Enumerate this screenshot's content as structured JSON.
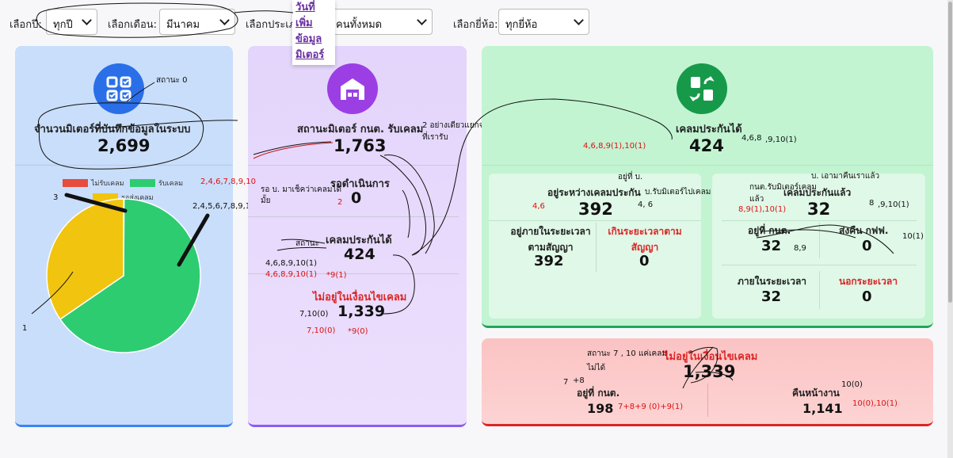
{
  "filters": {
    "year_label": "เลือกปี:",
    "year_value": "ทุกปี",
    "month_label": "เลือกเดือน:",
    "month_value": "มีนาคม",
    "type_label": "เลือกประเภ",
    "type_value": "คนทั้งหมด",
    "brand_label": "เลือกยี่ห้อ:",
    "brand_value": "ทุกยี่ห้อ"
  },
  "popup": {
    "line1": "วันที่",
    "line2": "เพิ่ม",
    "line3": "ข้อมูล",
    "line4": "มิเตอร์"
  },
  "card1": {
    "title": "จำนวนมิเตอร์ที่บันทึกข้อมูลในระบบ",
    "value": "2,699",
    "legend": [
      {
        "label": "ไม่รับเคลม",
        "color": "#e74c3c"
      },
      {
        "label": "รับเคลม",
        "color": "#2ecc71"
      },
      {
        "label": "รอส่งเคลม",
        "color": "#f1c40f"
      }
    ]
  },
  "chart_data": {
    "type": "pie",
    "categories": [
      "ไม่รับเคลม",
      "รับเคลม",
      "รอส่งเคลม"
    ],
    "values": [
      3,
      1763,
      933
    ],
    "colors": [
      "#e74c3c",
      "#2ecc71",
      "#f1c40f"
    ]
  },
  "card2": {
    "title": "สถานะมิเตอร์ กนต. รับเคลม",
    "value": "1,763",
    "pending_label": "รอดำเนินการ",
    "pending_value": "0",
    "claimable_label": "เคลมประกันได้",
    "claimable_value": "424",
    "notdam_label": "ไม่อยู่ในเงื่อนไขเคลม",
    "notdam_value": "1,339"
  },
  "card3": {
    "title": "เคลมประกันได้",
    "value": "424",
    "left_title": "อยู่ระหว่างเคลมประกัน",
    "left_value": "392",
    "left_a_label": "อยู่ภายในระยะเวลาตามสัญญา",
    "left_a_value": "392",
    "left_b_label": "เกินระยะเวลาตามสัญญา",
    "left_b_value": "0",
    "right_title": "เคลมประกันแล้ว",
    "right_value": "32",
    "right_a_label": "อยู่ที่ กนต.",
    "right_a_value": "32",
    "right_b_label": "ส่งคืน กฟฟ.",
    "right_b_value": "0",
    "right_c_label": "ภายในระยะเวลา",
    "right_c_value": "32",
    "right_d_label": "นอกระยะเวลา",
    "right_d_value": "0"
  },
  "card4": {
    "title": "ไม่อยู่ในเงื่อนไขเคลม",
    "value": "1,339",
    "left_label": "อยู่ที่ กนต.",
    "left_value": "198",
    "right_label": "คืนหน้างาน",
    "right_value": "1,141"
  },
  "notes": {
    "n_status0": "สถานะ 0",
    "n_c1_3": "3",
    "n_c1_1": "1",
    "n_c1_seq": "2,4,5,6,7,8,9,10",
    "n_c2_seq": "2,4,6,7,8,9,10",
    "n_c2_diff1": "2 อย่างเดียวแยกจากวัน",
    "n_c2_diff2": "ที่เรารับ",
    "n_c2_wait1": "รอ บ. มาเช็คว่าเคลมได้",
    "n_c2_wait2": "มั้ย",
    "n_c2_2": "2",
    "n_c2_status": "สถานะ",
    "n_c2_a": "4,6,8,9,10(1)",
    "n_c2_b": "4,6,8,9,10(1)",
    "n_c2_c": "*9(1)",
    "n_c2_d": "7,10(0)",
    "n_c2_e": "7,10(0)",
    "n_c2_f": "*9(0)",
    "n_c3_a": "4,6,8,9(1),10(1)",
    "n_c3_b": "4,6,8",
    "n_c3_c": ",9,10(1)",
    "n_c3_d": "อยู่ที่ บ.",
    "n_c3_e": "บ.รับมิเตอร์ไปเคลม",
    "n_c3_f": "4,6",
    "n_c3_g": "4, 6",
    "n_c3_h": "บ. เอามาคืนเราแล้ว",
    "n_c3_i": "กนต.รับมิเตอร์เคลม",
    "n_c3_j": "แล้ว",
    "n_c3_k": "8,9(1),10(1)",
    "n_c3_l": "8",
    "n_c3_m": ",9,10(1)",
    "n_c3_n": "8,9",
    "n_c3_o": "10(1)",
    "n_c4_a": "สถานะ 7 , 10 แค่เคลม",
    "n_c4_b": "ไม่ได้",
    "n_c4_c": "7",
    "n_c4_d": "+8",
    "n_c4_e": "7+8+9 (0)+9(1)",
    "n_c4_f": "10(0)",
    "n_c4_g": "10(0),10(1)"
  }
}
